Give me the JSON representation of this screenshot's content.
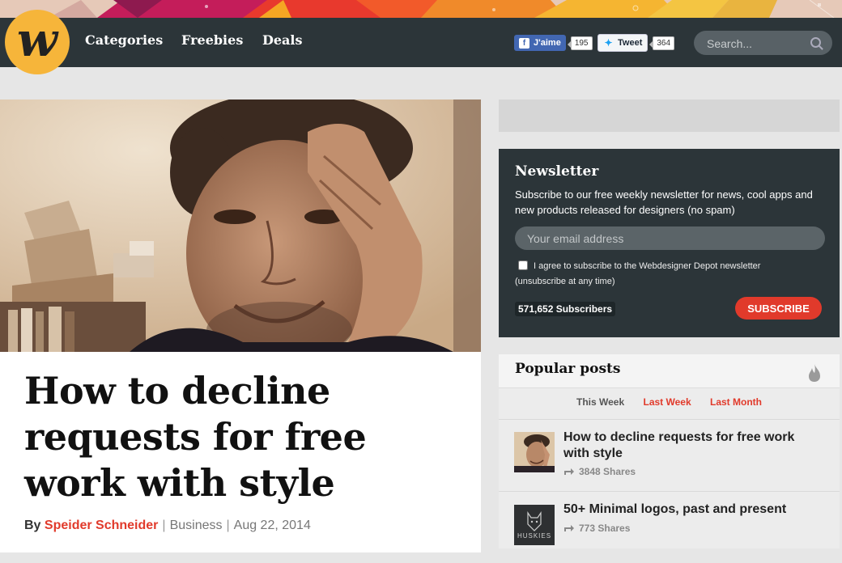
{
  "nav": {
    "logo_letter": "w",
    "links": [
      "Categories",
      "Freebies",
      "Deals"
    ],
    "facebook": {
      "label": "J'aime",
      "icon": "f",
      "count": "195"
    },
    "twitter": {
      "label": "Tweet",
      "icon": "✦",
      "count": "364"
    },
    "search_placeholder": "Search..."
  },
  "article": {
    "title": "How to decline requests for free work with style",
    "by": "By",
    "author": "Speider Schneider",
    "category": "Business",
    "date": "Aug 22, 2014",
    "separator": "|"
  },
  "newsletter": {
    "title": "Newsletter",
    "description": "Subscribe to our free weekly newsletter for news, cool apps and new products released for designers (no spam)",
    "email_placeholder": "Your email address",
    "agree_text": "I agree to subscribe to the Webdesigner Depot newsletter (unsubscribe at any time)",
    "subscribers": "571,652 Subscribers",
    "button": "SUBSCRIBE"
  },
  "popular": {
    "title": "Popular posts",
    "tabs": [
      "This Week",
      "Last Week",
      "Last Month"
    ],
    "posts": [
      {
        "title": "How to decline requests for free work with style",
        "shares": "3848 Shares"
      },
      {
        "title": "50+ Minimal logos, past and present",
        "shares": "773 Shares",
        "thumb_text": "HUSKIES"
      }
    ]
  },
  "colors": {
    "accent": "#e13a2b",
    "navbar": "#2c3539",
    "logo": "#f6b53a"
  }
}
